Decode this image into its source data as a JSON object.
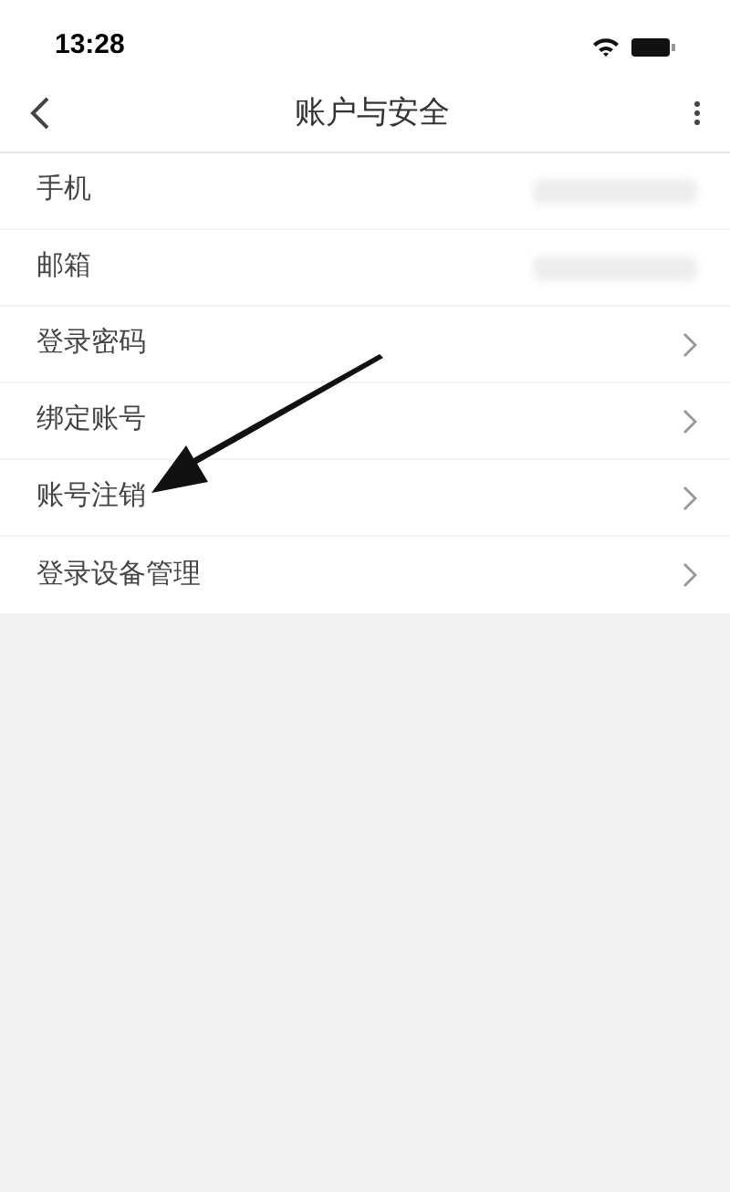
{
  "status_bar": {
    "time": "13:28"
  },
  "header": {
    "title": "账户与安全"
  },
  "rows": [
    {
      "label": "手机",
      "kind": "hidden-value"
    },
    {
      "label": "邮箱",
      "kind": "hidden-value"
    },
    {
      "label": "登录密码",
      "kind": "link"
    },
    {
      "label": "绑定账号",
      "kind": "link"
    },
    {
      "label": "账号注销",
      "kind": "link"
    },
    {
      "label": "登录设备管理",
      "kind": "link"
    }
  ]
}
